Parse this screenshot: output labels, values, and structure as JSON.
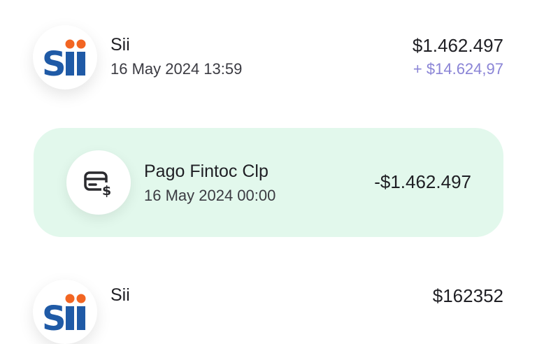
{
  "transactions": [
    {
      "merchant": "Sii",
      "datetime": "16 May 2024 13:59",
      "amount": "$1.462.497",
      "cashback": "+ $14.624,97",
      "logo": "sii-logo"
    },
    {
      "merchant": "Pago Fintoc Clp",
      "datetime": "16 May 2024 00:00",
      "amount": "-$1.462.497",
      "icon": "wallet-dollar-icon",
      "highlight_color": "#e2f8ec"
    },
    {
      "merchant": "Sii",
      "amount": "$162352",
      "logo": "sii-logo"
    }
  ],
  "colors": {
    "logo_blue": "#1f5aa6",
    "logo_orange": "#f26522",
    "cashback_purple": "#8a84d6"
  }
}
